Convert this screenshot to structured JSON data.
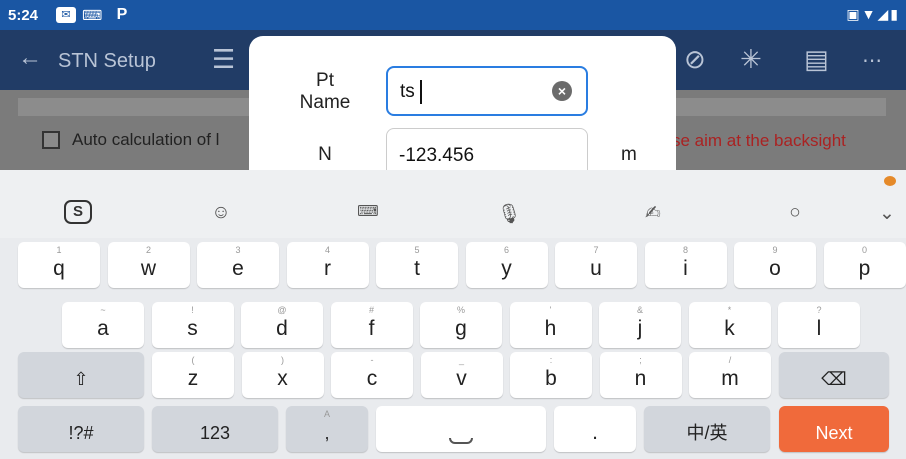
{
  "status_bar": {
    "time": "5:24",
    "icons_left": [
      "mail-icon",
      "keyboard-icon",
      "p-app-icon"
    ],
    "icons_right": [
      "cast-icon",
      "wifi-icon",
      "signal-icon",
      "battery-icon"
    ],
    "p_label": "P"
  },
  "app_bar": {
    "title": "STN Setup",
    "icons": [
      "back-arrow-icon",
      "menu-icon",
      "no-signal-icon",
      "satellite-icon",
      "list-icon",
      "more-icon"
    ]
  },
  "background": {
    "auto_calc_label": "Auto calculation of l",
    "warning_text": "se aim at the backsight"
  },
  "dialog": {
    "pt_name_label": "Pt\nName",
    "pt_name_value": "ts",
    "n_label": "N",
    "n_value": "-123.456",
    "n_unit": "m"
  },
  "keyboard": {
    "toolbar_icons": [
      "sogou-icon",
      "emoji-icon",
      "keyboard-layout-icon",
      "mic-icon",
      "handwriting-icon",
      "search-icon",
      "collapse-icon"
    ],
    "row1": [
      {
        "k": "q",
        "h": "1"
      },
      {
        "k": "w",
        "h": "2"
      },
      {
        "k": "e",
        "h": "3"
      },
      {
        "k": "r",
        "h": "4"
      },
      {
        "k": "t",
        "h": "5"
      },
      {
        "k": "y",
        "h": "6"
      },
      {
        "k": "u",
        "h": "7"
      },
      {
        "k": "i",
        "h": "8"
      },
      {
        "k": "o",
        "h": "9"
      },
      {
        "k": "p",
        "h": "0"
      }
    ],
    "row2": [
      {
        "k": "a",
        "h": "~"
      },
      {
        "k": "s",
        "h": "!"
      },
      {
        "k": "d",
        "h": "@"
      },
      {
        "k": "f",
        "h": "#"
      },
      {
        "k": "g",
        "h": "%"
      },
      {
        "k": "h",
        "h": "'"
      },
      {
        "k": "j",
        "h": "&"
      },
      {
        "k": "k",
        "h": "*"
      },
      {
        "k": "l",
        "h": "?"
      }
    ],
    "row3": [
      {
        "k": "z",
        "h": "("
      },
      {
        "k": "x",
        "h": ")"
      },
      {
        "k": "c",
        "h": "-"
      },
      {
        "k": "v",
        "h": "_"
      },
      {
        "k": "b",
        "h": ":"
      },
      {
        "k": "n",
        "h": ";"
      },
      {
        "k": "m",
        "h": "/"
      }
    ],
    "shift_glyph": "⇧",
    "backspace_glyph": "⌫",
    "sym_label": "!?#",
    "num_label": "123",
    "comma_label": ",",
    "comma_hint": "A",
    "period_label": ".",
    "lang_label": "中/英",
    "next_label": "Next"
  }
}
